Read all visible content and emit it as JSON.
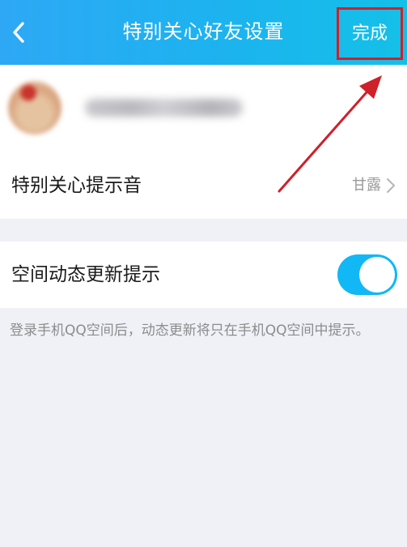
{
  "header": {
    "title": "特别关心好友设置",
    "back_icon": "chevron-left-icon",
    "done_label": "完成"
  },
  "friend": {
    "avatar_icon": "avatar",
    "name_blurred": true
  },
  "sound": {
    "label": "特别关心提示音",
    "value": "甘露",
    "chevron_icon": "chevron-right-icon"
  },
  "zone_updates": {
    "label": "空间动态更新提示",
    "enabled": true,
    "hint": "登录手机QQ空间后，动态更新将只在手机QQ空间中提示。"
  },
  "colors": {
    "header_start": "#2ea8f5",
    "header_end": "#14c0e8",
    "toggle_on": "#12b7f5",
    "annotation": "#d0202a",
    "background": "#eff1f6"
  }
}
